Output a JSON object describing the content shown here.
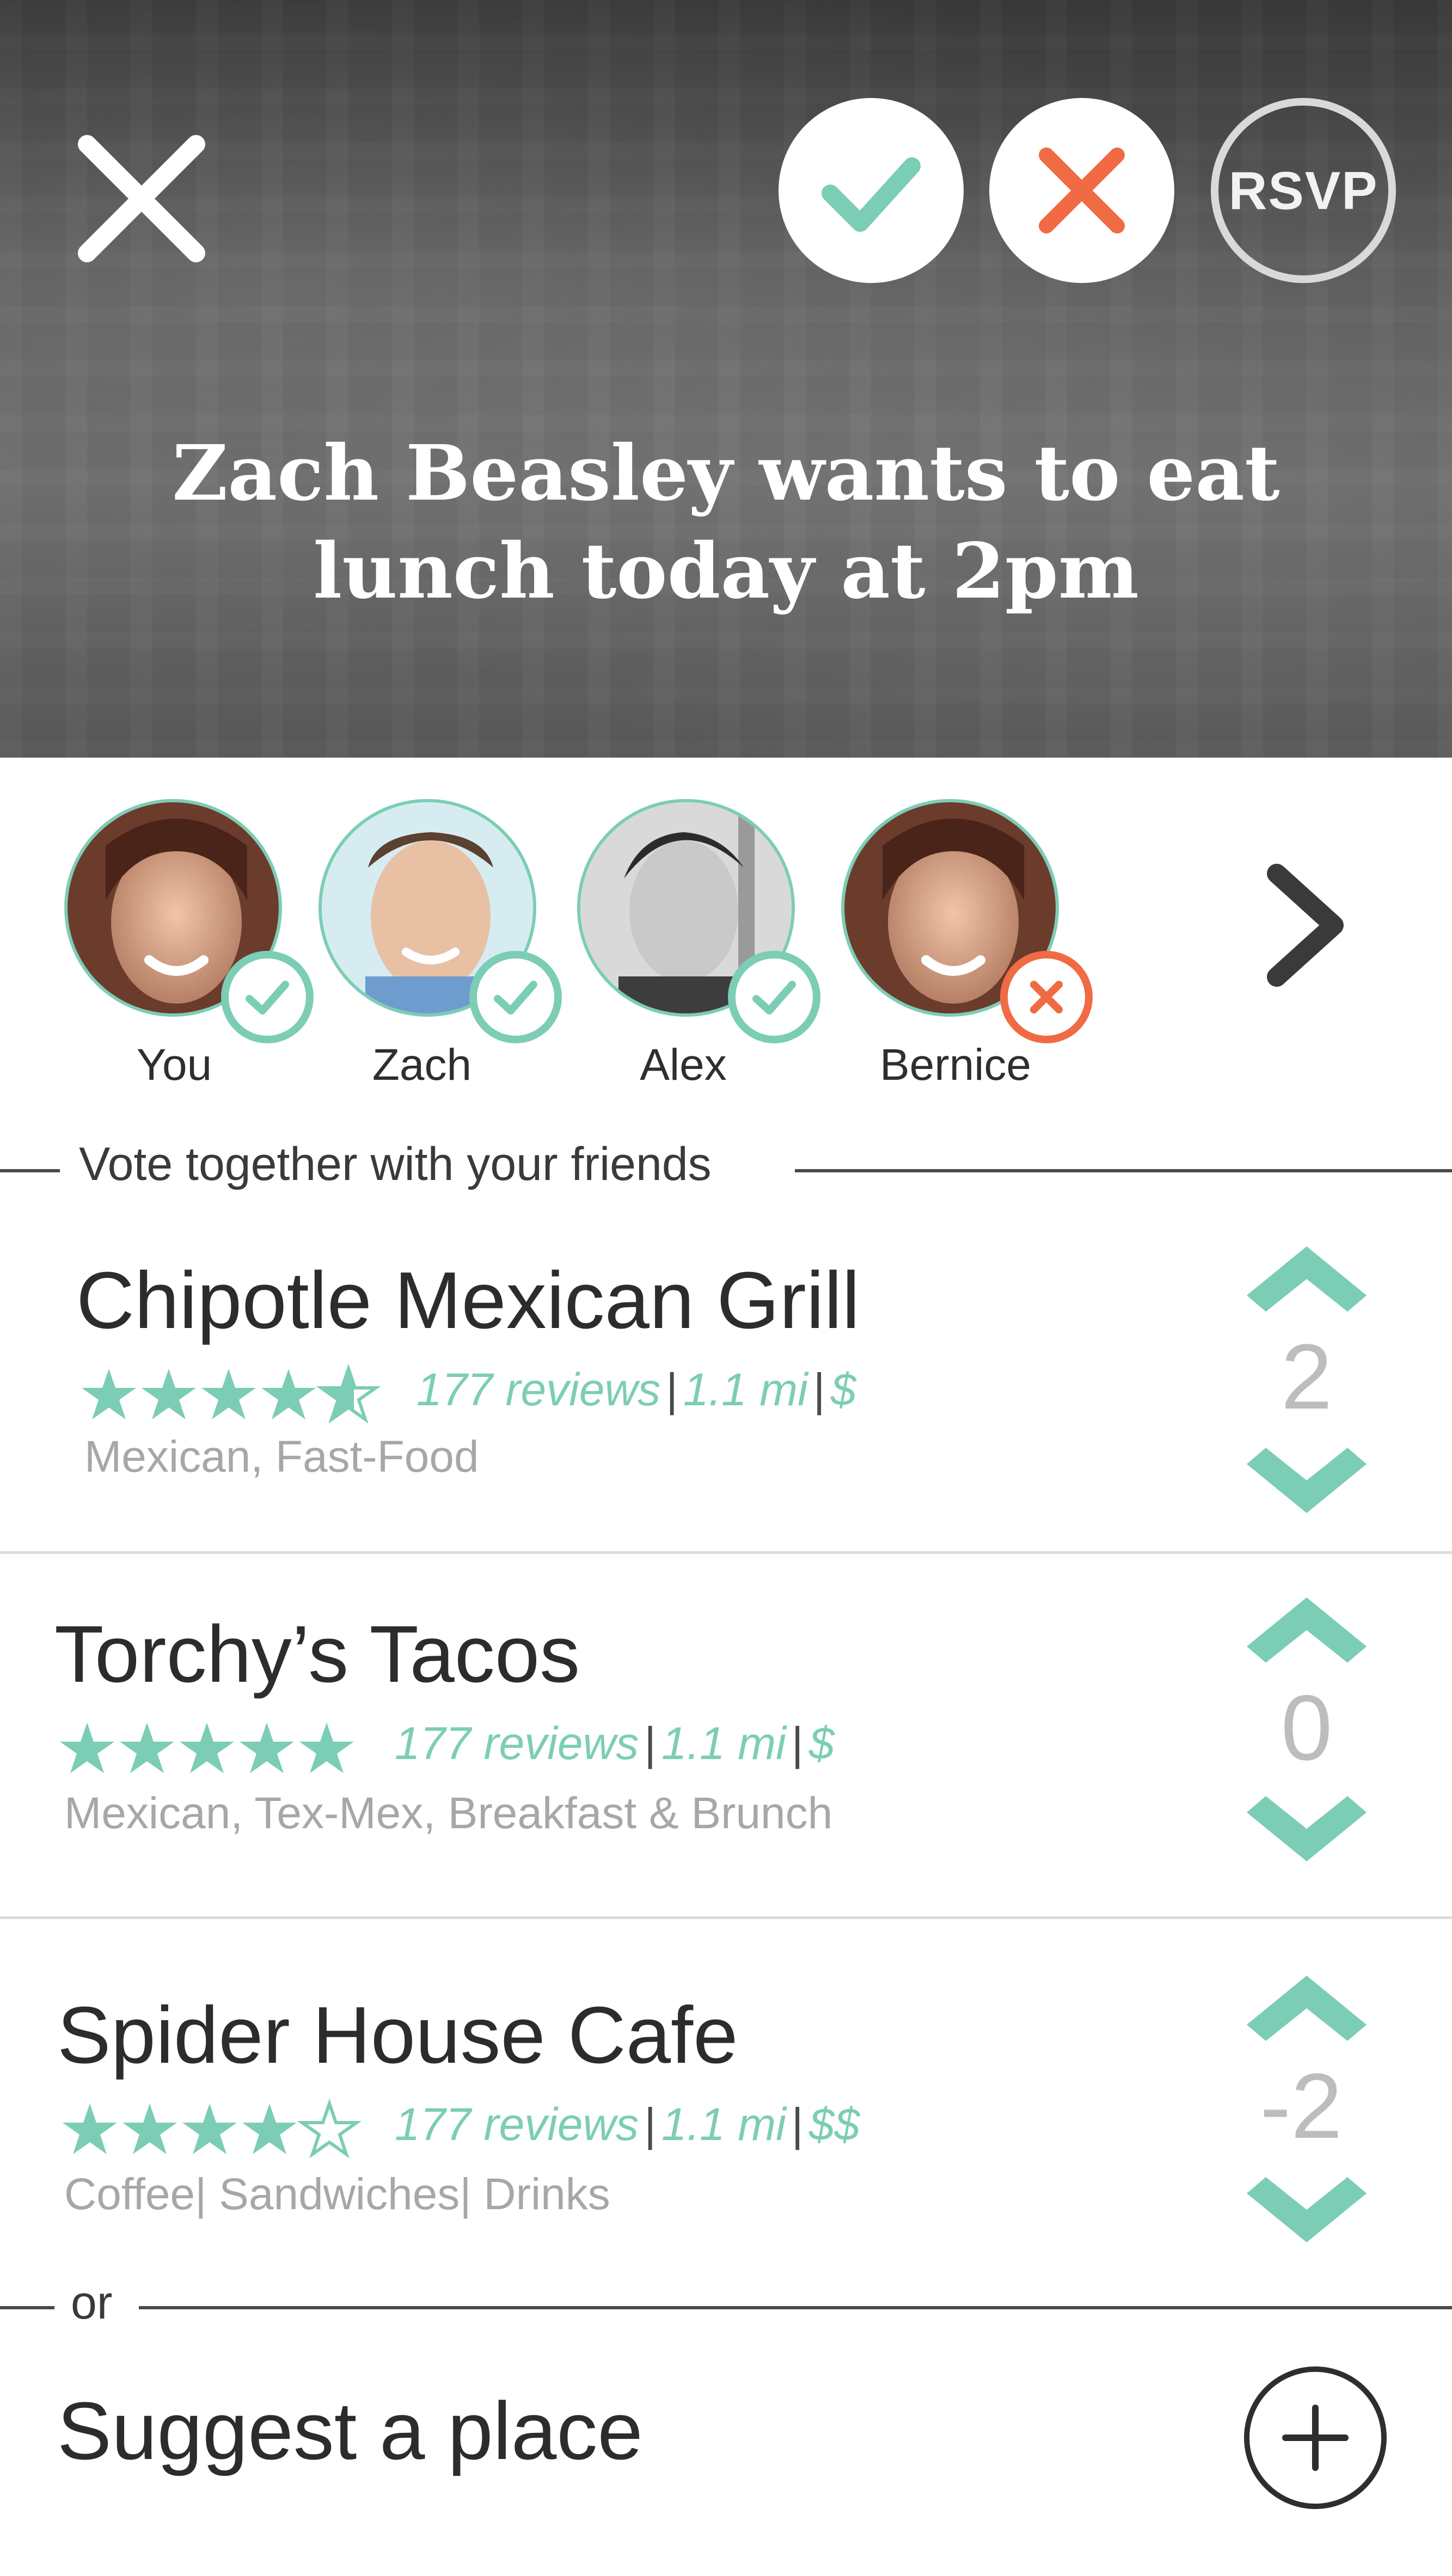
{
  "header": {
    "title": "Zach Beasley wants to eat lunch today at 2pm",
    "rsvp_label": "RSVP"
  },
  "colors": {
    "accent": "#7ccdb5",
    "decline": "#f06b43",
    "text_dark": "#2c2c2c",
    "muted": "#a7a7a7"
  },
  "attendees": [
    {
      "name": "You",
      "status": "accepted"
    },
    {
      "name": "Zach",
      "status": "accepted"
    },
    {
      "name": "Alex",
      "status": "accepted"
    },
    {
      "name": "Bernice",
      "status": "declined"
    }
  ],
  "vote_section": {
    "label": "Vote together with your friends"
  },
  "restaurants": [
    {
      "name": "Chipotle Mexican Grill",
      "rating": 4.5,
      "reviews": "177 reviews",
      "distance": "1.1 mi",
      "price": "$",
      "tags": "Mexican, Fast-Food",
      "votes": "2"
    },
    {
      "name": "Torchy’s Tacos",
      "rating": 5,
      "reviews": "177 reviews",
      "distance": "1.1 mi",
      "price": "$",
      "tags": "Mexican, Tex-Mex, Breakfast & Brunch",
      "votes": "0"
    },
    {
      "name": "Spider House Cafe",
      "rating": 4,
      "reviews": "177 reviews",
      "distance": "1.1 mi",
      "price": "$$",
      "tags": "Coffee| Sandwiches| Drinks",
      "votes": "-2"
    }
  ],
  "suggest": {
    "or_label": "or",
    "label": "Suggest a place"
  },
  "icons": {
    "close": "close-icon",
    "accept": "check-icon",
    "decline": "x-icon",
    "next": "chevron-right-icon",
    "upvote": "chevron-up-icon",
    "downvote": "chevron-down-icon",
    "add": "plus-icon",
    "star": "star-icon"
  }
}
